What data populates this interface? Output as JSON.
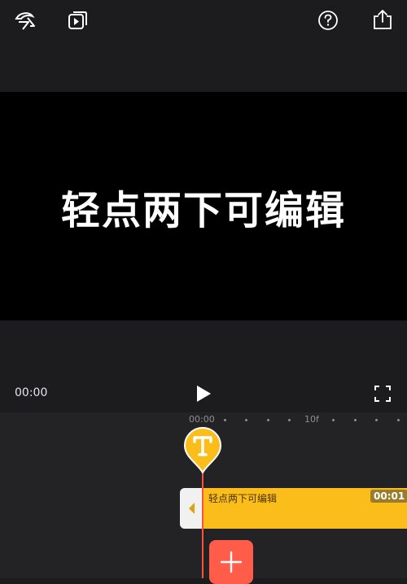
{
  "preview": {
    "caption": "轻点两下可编辑"
  },
  "player": {
    "current_time": "00:00"
  },
  "ruler": {
    "start_label": "00:00",
    "mid_label": "10f"
  },
  "clip": {
    "label": "轻点两下可编辑",
    "duration": "00:01",
    "color": "#fbbd1a"
  },
  "colors": {
    "accent": "#ff5c4a",
    "playhead": "#ff4f3d",
    "background": "#1c1c1e"
  },
  "icons": [
    "logo-icon",
    "preview-play-icon",
    "help-icon",
    "share-icon",
    "play-icon",
    "fullscreen-icon",
    "text-marker-icon",
    "plus-icon"
  ]
}
